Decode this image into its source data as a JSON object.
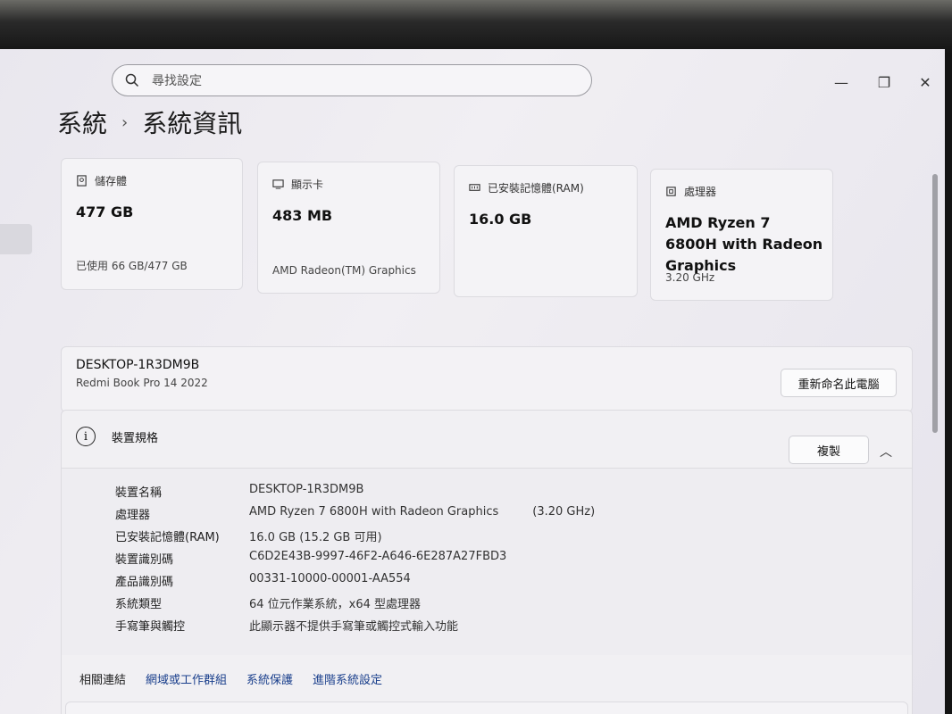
{
  "search": {
    "placeholder": "尋找設定"
  },
  "window": {
    "minimize": "—",
    "restore": "❐",
    "close": "✕"
  },
  "breadcrumb": {
    "parent": "系統",
    "separator": "›",
    "current": "系統資訊"
  },
  "cards": [
    {
      "icon": "storage-icon",
      "label": "儲存體",
      "value": "477 GB",
      "sub": "已使用 66 GB/477 GB"
    },
    {
      "icon": "display-icon",
      "label": "顯示卡",
      "value": "483 MB",
      "sub": "AMD Radeon(TM) Graphics"
    },
    {
      "icon": "ram-icon",
      "label": "已安裝記憶體(RAM)",
      "value": "16.0 GB",
      "sub": ""
    },
    {
      "icon": "processor-icon",
      "label": "處理器",
      "value": "AMD Ryzen 7 6800H with Radeon Graphics",
      "sub": "3.20 GHz"
    }
  ],
  "device": {
    "name": "DESKTOP-1R3DM9B",
    "model": "Redmi Book Pro 14 2022",
    "rename_button": "重新命名此電腦"
  },
  "specs": {
    "title": "裝置規格",
    "copy_button": "複製",
    "rows": [
      {
        "label": "裝置名稱",
        "value": "DESKTOP-1R3DM9B",
        "extra": ""
      },
      {
        "label": "處理器",
        "value": "AMD Ryzen 7 6800H with Radeon Graphics",
        "extra": "(3.20 GHz)"
      },
      {
        "label": "已安裝記憶體(RAM)",
        "value": "16.0 GB (15.2 GB 可用)",
        "extra": ""
      },
      {
        "label": "裝置識別碼",
        "value": "C6D2E43B-9997-46F2-A646-6E287A27FBD3",
        "extra": ""
      },
      {
        "label": "產品識別碼",
        "value": "00331-10000-00001-AA554",
        "extra": ""
      },
      {
        "label": "系統類型",
        "value": "64 位元作業系統，x64 型處理器",
        "extra": ""
      },
      {
        "label": "手寫筆與觸控",
        "value": "此顯示器不提供手寫筆或觸控式輸入功能",
        "extra": ""
      }
    ]
  },
  "related": {
    "label": "相關連結",
    "links": [
      "網域或工作群組",
      "系統保護",
      "進階系統設定"
    ]
  }
}
